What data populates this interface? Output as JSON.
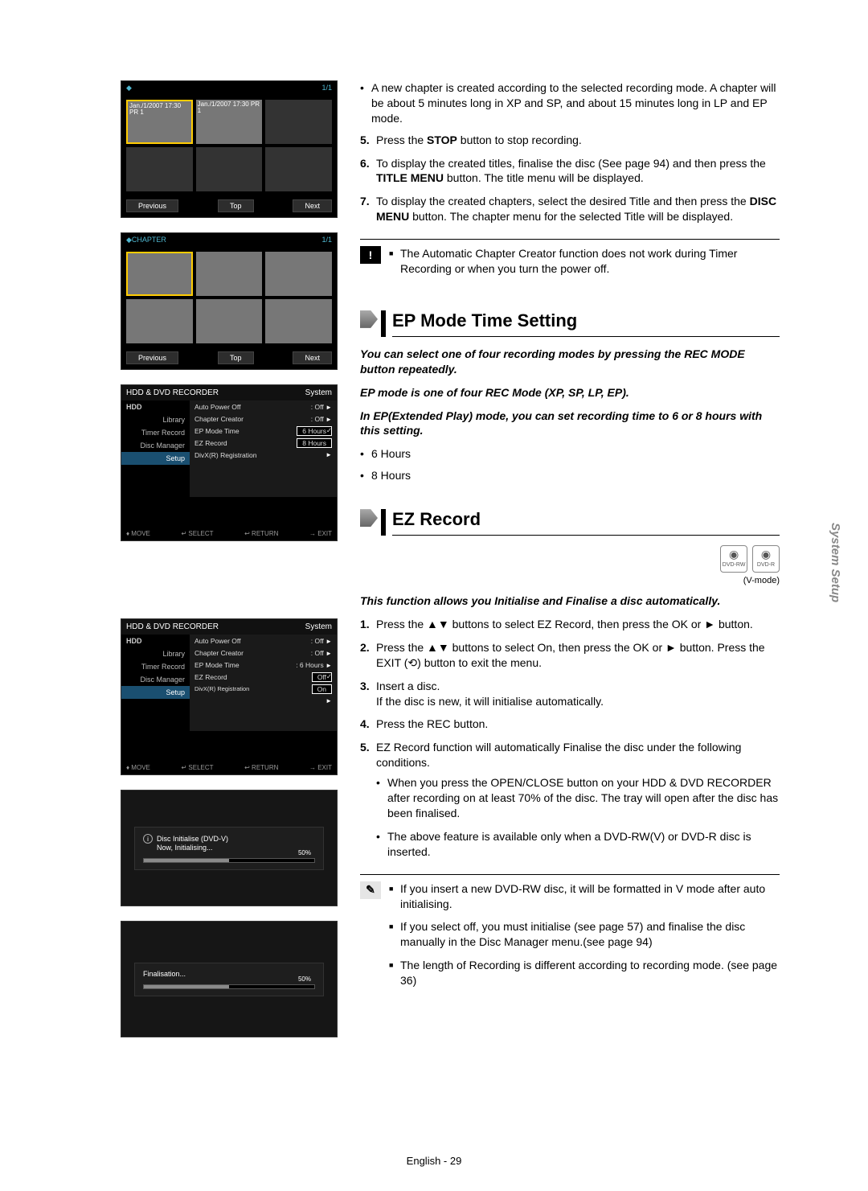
{
  "thumbs": {
    "pg": "1/1",
    "cap1": "Jan./1/2007\n17:30 PR 1",
    "cap2": "Jan./1/2007\n17:30 PR 1",
    "chapter_label": "CHAPTER",
    "prev": "Previous",
    "top": "Top",
    "next": "Next"
  },
  "menu1": {
    "title": "HDD & DVD RECORDER",
    "section": "System",
    "hdd": "HDD",
    "items": [
      "Library",
      "Timer Record",
      "Disc Manager",
      "Setup"
    ],
    "opts": [
      {
        "label": "Auto Power Off",
        "value": ": Off",
        "arrow": "►"
      },
      {
        "label": "Chapter Creator",
        "value": ": Off",
        "arrow": "►"
      },
      {
        "label": "EP Mode Time",
        "value": "6 Hours",
        "boxed": true,
        "check": true
      },
      {
        "label": "EZ Record",
        "value": "8 Hours",
        "boxed": true
      },
      {
        "label": "DivX(R) Registration",
        "value": "",
        "arrow": "►"
      }
    ],
    "foot": [
      "♦ MOVE",
      "↵ SELECT",
      "↩ RETURN",
      "→ EXIT"
    ]
  },
  "menu2": {
    "title": "HDD & DVD RECORDER",
    "section": "System",
    "hdd": "HDD",
    "items": [
      "Library",
      "Timer Record",
      "Disc Manager",
      "Setup"
    ],
    "opts": [
      {
        "label": "Auto Power Off",
        "value": ": Off",
        "arrow": "►"
      },
      {
        "label": "Chapter Creator",
        "value": ": Off",
        "arrow": "►"
      },
      {
        "label": "EP Mode Time",
        "value": ": 6 Hours",
        "arrow": "►"
      },
      {
        "label": "EZ Record",
        "value": "Off",
        "boxed": true,
        "check": true
      },
      {
        "label": "DivX(R) Registration",
        "value": "On",
        "boxed": true
      },
      {
        "label": "",
        "value": "",
        "arrow": "►"
      }
    ],
    "foot": [
      "♦ MOVE",
      "↵ SELECT",
      "↩ RETURN",
      "→ EXIT"
    ]
  },
  "toast1": {
    "line1": "Disc Initialise (DVD-V)",
    "line2": "Now, Initialising...",
    "pct": "50%"
  },
  "toast2": {
    "line1": "Finalisation...",
    "pct": "50%"
  },
  "intro": {
    "b1": "A new chapter is created according to the selected recording mode. A chapter will be about 5 minutes long in XP and SP, and about 15 minutes long in LP and EP mode.",
    "n5a": "Press the ",
    "n5b": " button to stop recording.",
    "stop": "STOP",
    "n6a": "To display the created titles, finalise the disc (See page 94) and then press the ",
    "n6b": " button. The title menu will be displayed.",
    "titlemenu": "TITLE MENU",
    "n7a": "To display the created chapters, select the desired Title and then press the ",
    "n7b": " button. The chapter menu for the selected Title will be displayed.",
    "discmenu": "DISC MENU",
    "notebox1": "The Automatic Chapter Creator function does not work during Timer Recording or when you turn the power off."
  },
  "ep": {
    "heading": "EP Mode Time Setting",
    "ital1": "You can select one of four recording modes by pressing the REC MODE button repeatedly.",
    "ital2": "EP mode is one of four REC Mode (XP, SP, LP, EP).",
    "ital3": "In EP(Extended Play) mode, you can set recording time to 6 or 8 hours with this setting.",
    "b1": "6 Hours",
    "b2": "8 Hours"
  },
  "ez": {
    "heading": "EZ Record",
    "disc1": "DVD-RW",
    "disc2": "DVD-R",
    "vmode": "(V-mode)",
    "ital": "This function allows you Initialise and Finalise a disc automatically.",
    "n1": "Press the ▲▼ buttons to select EZ Record, then press the OK or ► button.",
    "n2": "Press the ▲▼ buttons to select On, then press the OK or ► button. Press the EXIT (⟲) button to exit the menu.",
    "n3a": "Insert a disc.",
    "n3b": "If the disc is new, it will initialise automatically.",
    "n4": "Press the REC button.",
    "n5a": "EZ Record function will automatically Finalise the disc under the following conditions.",
    "n5s1": "When you press the OPEN/CLOSE button on your HDD & DVD RECORDER after recording on at least 70% of the disc. The tray will open after the disc has been finalised.",
    "n5s2": "The above feature is available only when a DVD-RW(V) or DVD-R disc is inserted.",
    "note1": "If you insert a new DVD-RW disc, it will be formatted in V mode after auto initialising.",
    "note2": "If you select off, you must initialise (see page 57) and finalise the disc manually in the Disc Manager menu.(see page 94)",
    "note3": "The length of Recording is different according to recording mode. (see page 36)"
  },
  "side": "System Setup",
  "footer": "English - 29"
}
